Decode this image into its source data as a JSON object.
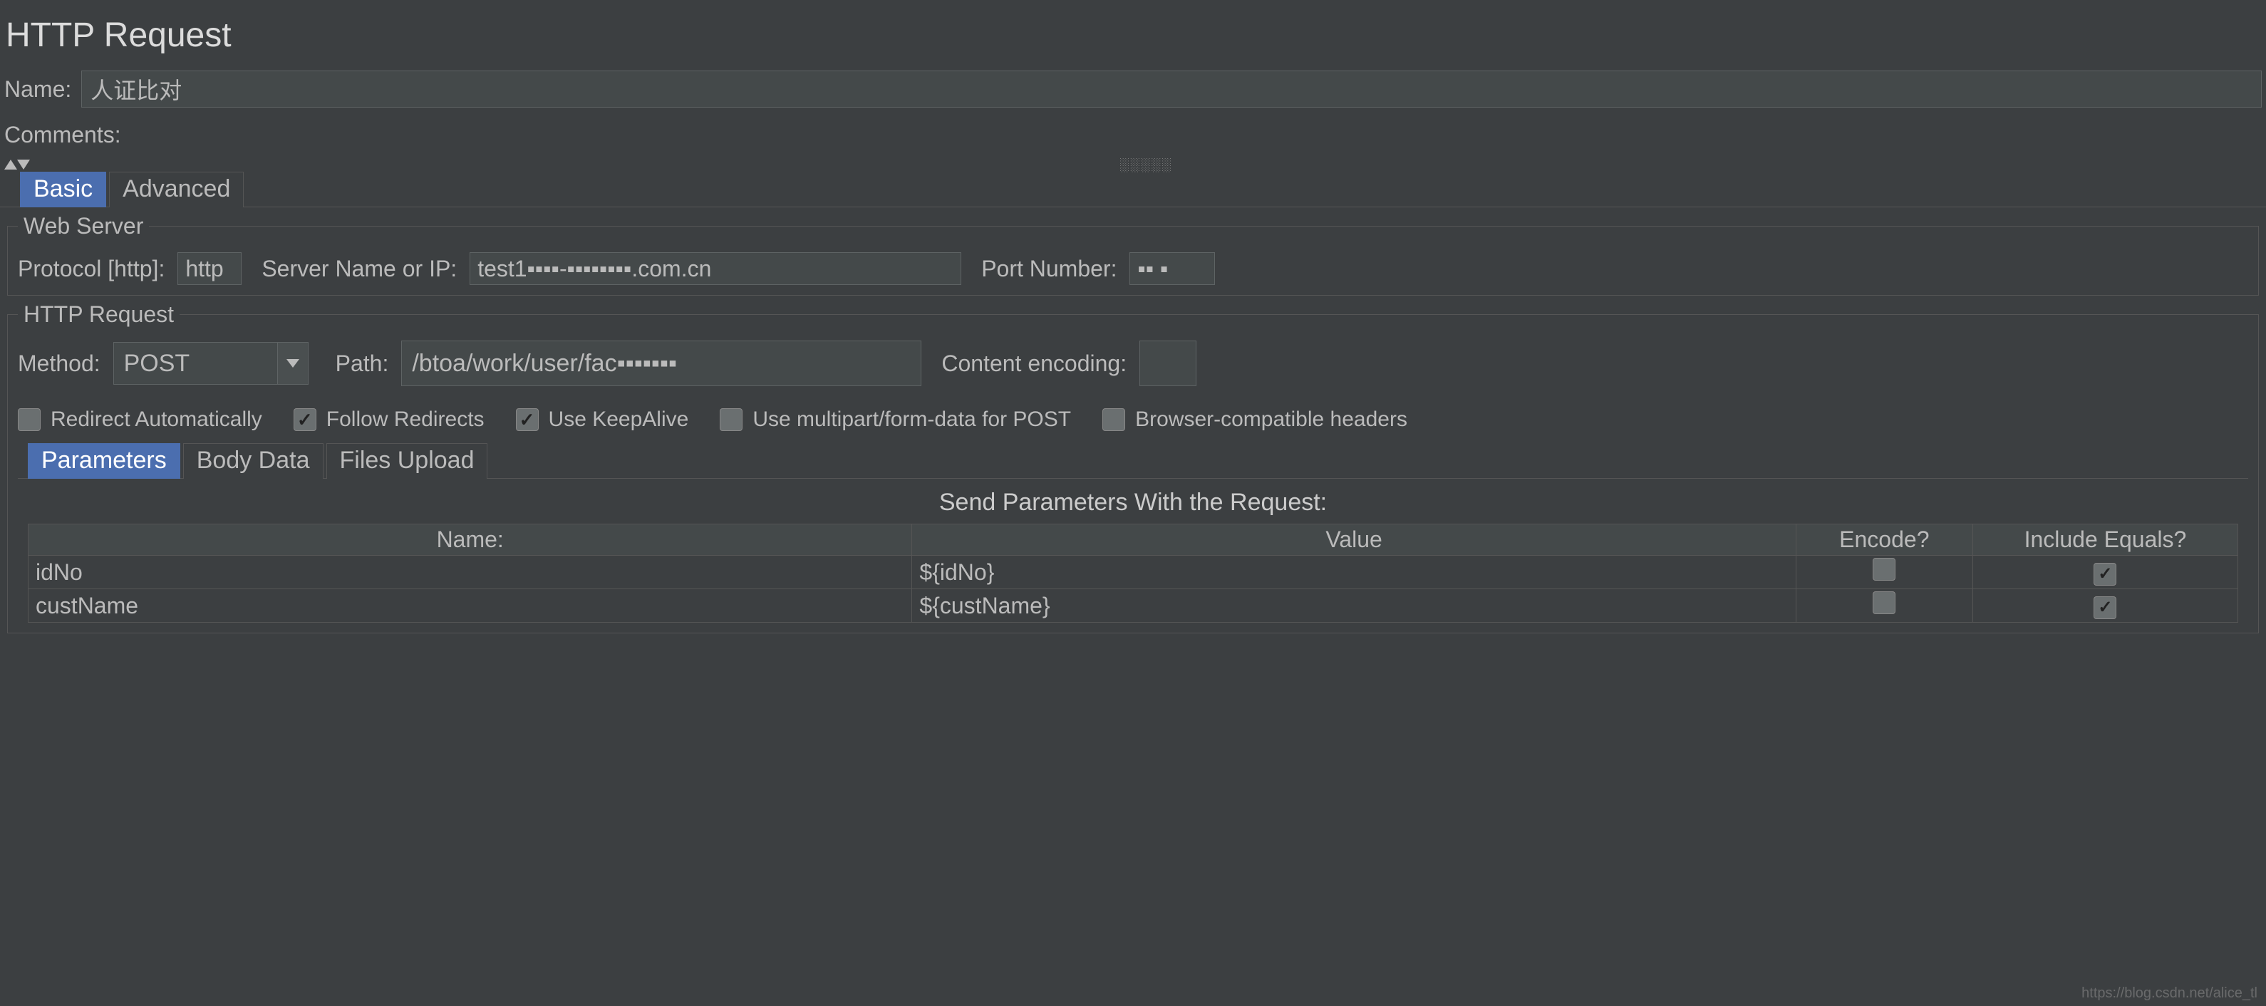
{
  "panel_title": "HTTP Request",
  "name_label": "Name:",
  "name_value": "人证比对",
  "comments_label": "Comments:",
  "comments_value": "",
  "main_tabs": {
    "basic": "Basic",
    "advanced": "Advanced"
  },
  "web_server": {
    "legend": "Web Server",
    "protocol_label": "Protocol [http]:",
    "protocol_value": "http",
    "server_label": "Server Name or IP:",
    "server_value": "test1▪▪▪▪-▪▪▪▪▪▪▪▪.com.cn",
    "port_label": "Port Number:",
    "port_value": "▪▪ ▪"
  },
  "http_request": {
    "legend": "HTTP Request",
    "method_label": "Method:",
    "method_value": "POST",
    "path_label": "Path:",
    "path_value": "/btoa/work/user/fac▪▪▪▪▪▪▪",
    "content_encoding_label": "Content encoding:",
    "content_encoding_value": "",
    "checks": {
      "redirect_auto": "Redirect Automatically",
      "follow_redirects": "Follow Redirects",
      "keepalive": "Use KeepAlive",
      "multipart": "Use multipart/form-data for POST",
      "browser_headers": "Browser-compatible headers"
    }
  },
  "param_tabs": {
    "parameters": "Parameters",
    "body_data": "Body Data",
    "files_upload": "Files Upload"
  },
  "params_section_title": "Send Parameters With the Request:",
  "params_headers": {
    "name": "Name:",
    "value": "Value",
    "encode": "Encode?",
    "include_equals": "Include Equals?"
  },
  "params_rows": [
    {
      "name": "idNo",
      "value": "${idNo}",
      "encode": false,
      "include_equals": true
    },
    {
      "name": "custName",
      "value": "${custName}",
      "encode": false,
      "include_equals": true
    }
  ],
  "watermark": "https://blog.csdn.net/alice_tl"
}
